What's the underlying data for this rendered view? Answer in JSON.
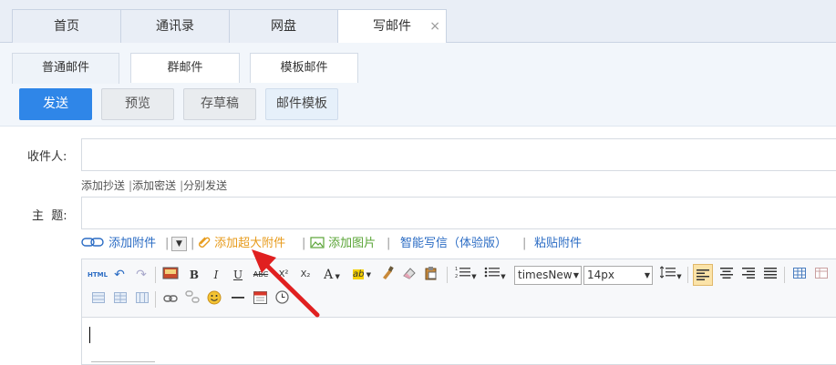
{
  "top_tabs": [
    {
      "label": "首页"
    },
    {
      "label": "通讯录"
    },
    {
      "label": "网盘"
    },
    {
      "label": "写邮件",
      "close": "×"
    }
  ],
  "sub_tabs": [
    {
      "label": "普通邮件"
    },
    {
      "label": "群邮件"
    },
    {
      "label": "模板邮件"
    }
  ],
  "actions": {
    "send": "发送",
    "preview": "预览",
    "save_draft": "存草稿",
    "template": "邮件模板"
  },
  "form": {
    "recipient_label": "收件人:",
    "recipient_value": "",
    "recipient_links": [
      "添加抄送",
      "添加密送",
      "分别发送"
    ],
    "subject_label": "主  题:",
    "subject_value": ""
  },
  "attach": {
    "add_attachment": "添加附件",
    "add_large": "添加超大附件",
    "add_image": "添加图片",
    "smart_write": "智能写信（体验版）",
    "paste_attachment": "粘贴附件"
  },
  "editor": {
    "font_family": "timesNew",
    "font_size": "14px",
    "html_label": "HTML",
    "bold": "B",
    "italic": "I",
    "underline": "U",
    "strike": "ABC",
    "superscript": "X²",
    "subscript": "X₂",
    "font_color": "A",
    "highlight": "ab"
  },
  "colors": {
    "accent": "#2f86e8",
    "link_blue": "#2b6cc4",
    "orange": "#e79b1c",
    "green": "#5aa436",
    "annotation_red": "#e02020"
  }
}
